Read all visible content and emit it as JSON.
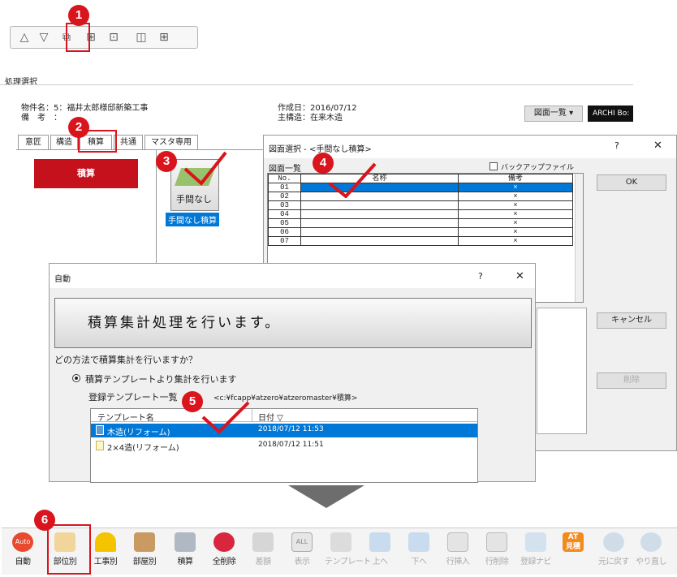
{
  "badges": [
    "1",
    "2",
    "3",
    "4",
    "5",
    "6"
  ],
  "toolbar_top": {
    "icons": [
      "triangle-up-icon",
      "triangle-down-icon",
      "window-select-icon",
      "copy-window-icon",
      "edit-window-icon",
      "split-horizontal-icon",
      "split-grid-icon"
    ],
    "glyphs": [
      "△",
      "▽",
      "⧉",
      "⊞",
      "⊡",
      "◫",
      "⊞"
    ]
  },
  "main_panel": {
    "title": "処理選択",
    "property_name": "物件名：5：福井太郎様邸新築工事",
    "remarks": "備　考　：",
    "created": "作成日：2016/07/12",
    "structure": "主構造：在来木造",
    "drawing_list_btn": "図面一覧 ▾",
    "archi_btn": "ARCHI Bo:",
    "tabs": [
      "意匠",
      "構造",
      "積算",
      "共通",
      "マスタ専用"
    ],
    "sekisan_button": "積算",
    "tenmanashi_icon_text": "手間なし",
    "tenmanashi_label": "手間なし積算"
  },
  "drawing_dialog": {
    "title": "図面選択 - <手間なし積算>",
    "help": "?",
    "close": "✕",
    "list_label": "図面一覧",
    "backup_label": "バックアップファイル",
    "col_no": "No.",
    "col_name": "名称",
    "col_note": "備考",
    "rows": [
      {
        "no": "01",
        "note": "×"
      },
      {
        "no": "02",
        "note": "×"
      },
      {
        "no": "03",
        "note": "×"
      },
      {
        "no": "04",
        "note": "×"
      },
      {
        "no": "05",
        "note": "×"
      },
      {
        "no": "06",
        "note": "×"
      },
      {
        "no": "07",
        "note": "×"
      }
    ],
    "ok": "OK",
    "cancel": "キャンセル",
    "delete": "削除"
  },
  "auto_dialog": {
    "title": "自動",
    "help": "?",
    "close": "✕",
    "message": "積算集計処理を行います。",
    "question": "どの方法で積算集計を行いますか？",
    "radio_label": "積算テンプレートより集計を行います",
    "template_list_label": "登録テンプレート一覧",
    "template_path": "<c:¥fcapp¥atzero¥atzeromaster¥積算>",
    "col_name": "テンプレート名",
    "col_date": "日付 ▽",
    "templates": [
      {
        "name": "木造(リフォーム)",
        "date": "2018/07/12 11:53"
      },
      {
        "name": "2×4造(リフォーム)",
        "date": "2018/07/12 11:51"
      }
    ]
  },
  "bottom_toolbar": {
    "buttons": [
      {
        "label": "自動",
        "icon": "auto-icon"
      },
      {
        "label": "部位別",
        "icon": "part-icon"
      },
      {
        "label": "工事別",
        "icon": "helmet-icon"
      },
      {
        "label": "部屋別",
        "icon": "room-icon"
      },
      {
        "label": "積算",
        "icon": "estimate-icon"
      },
      {
        "label": "全削除",
        "icon": "delete-all-icon"
      },
      {
        "label": "差額",
        "icon": "diff-icon"
      },
      {
        "label": "表示",
        "icon": "display-all-icon"
      },
      {
        "label": "テンプレート",
        "icon": "template-icon"
      },
      {
        "label": "上へ",
        "icon": "arrow-up-icon"
      },
      {
        "label": "下へ",
        "icon": "arrow-down-icon"
      },
      {
        "label": "行挿入",
        "icon": "row-insert-icon"
      },
      {
        "label": "行削除",
        "icon": "row-delete-icon"
      },
      {
        "label": "登録ナビ",
        "icon": "register-navi-icon"
      },
      {
        "label": "見積",
        "icon": "at-estimate-icon"
      },
      {
        "label": "元に戻す",
        "icon": "undo-icon"
      },
      {
        "label": "やり直し",
        "icon": "redo-icon"
      }
    ],
    "auto_tag": "Auto",
    "at_tag": "AT",
    "all_tag": "ALL"
  },
  "colors": {
    "accent_red": "#d9141c",
    "selection_blue": "#0078d7"
  }
}
